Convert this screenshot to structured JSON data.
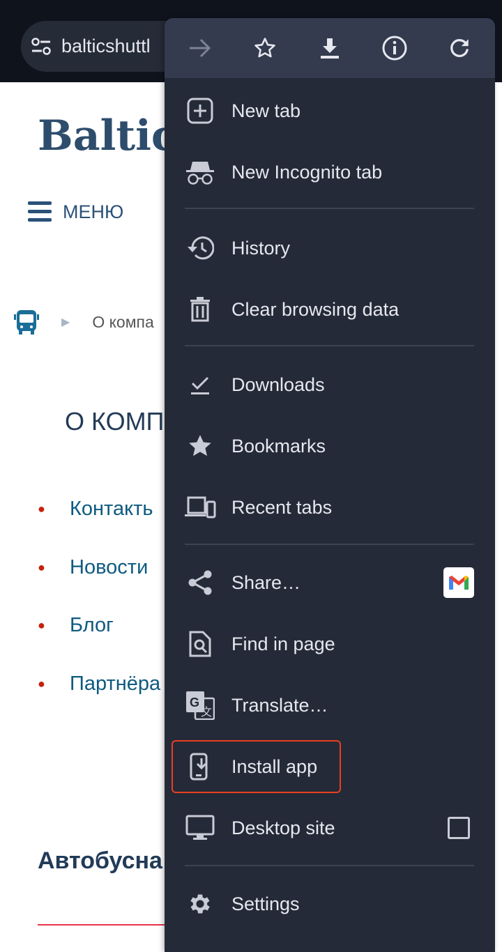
{
  "browser": {
    "url": "balticshuttl"
  },
  "page": {
    "logo": "Baltic",
    "menu_label": "МЕНЮ",
    "breadcrumb": "О компа",
    "heading": "О КОМП",
    "links": [
      "Контакть",
      "Новости",
      "Блог",
      "Партнёра"
    ],
    "subheading": "Автобусна"
  },
  "menu": {
    "toolbar": [
      "forward-icon",
      "bookmark-star-icon",
      "download-icon",
      "info-icon",
      "reload-icon"
    ],
    "items": [
      {
        "label": "New tab",
        "icon": "new-tab-icon"
      },
      {
        "label": "New Incognito tab",
        "icon": "incognito-icon"
      },
      {
        "label": "History",
        "icon": "history-icon"
      },
      {
        "label": "Clear browsing data",
        "icon": "trash-icon"
      },
      {
        "label": "Downloads",
        "icon": "downloads-icon"
      },
      {
        "label": "Bookmarks",
        "icon": "star-icon"
      },
      {
        "label": "Recent tabs",
        "icon": "devices-icon"
      },
      {
        "label": "Share…",
        "icon": "share-icon"
      },
      {
        "label": "Find in page",
        "icon": "find-in-page-icon"
      },
      {
        "label": "Translate…",
        "icon": "translate-icon"
      },
      {
        "label": "Install app",
        "icon": "install-app-icon"
      },
      {
        "label": "Desktop site",
        "icon": "desktop-icon",
        "checked": false
      },
      {
        "label": "Settings",
        "icon": "gear-icon"
      }
    ],
    "highlight_color": "#e8401f"
  }
}
